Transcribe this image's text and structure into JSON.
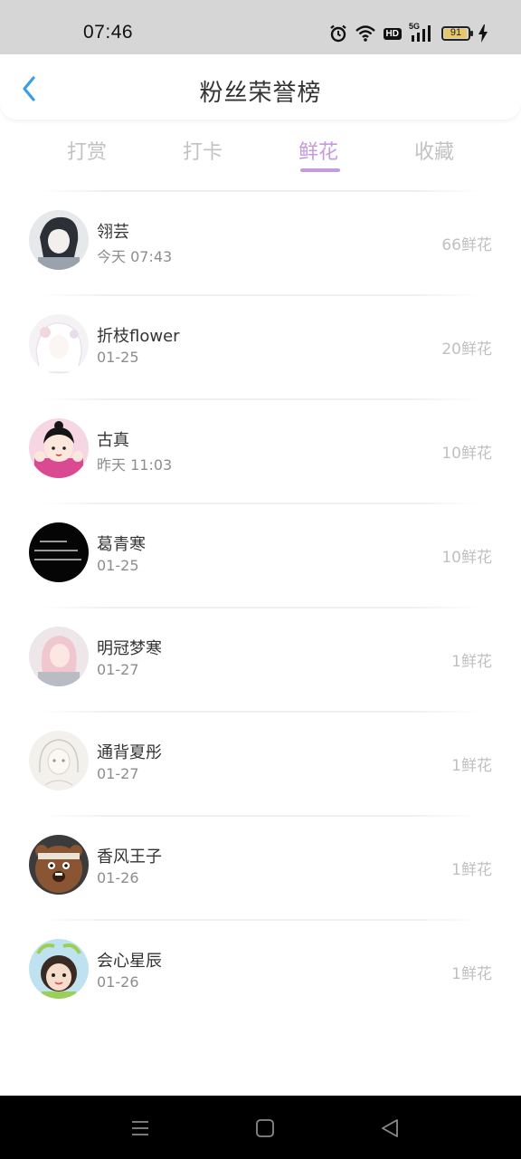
{
  "status_bar": {
    "time": "07:46",
    "network": "5G",
    "hd": "HD",
    "battery": "91"
  },
  "header": {
    "title": "粉丝荣誉榜"
  },
  "tabs": [
    {
      "label": "打赏"
    },
    {
      "label": "打卡"
    },
    {
      "label": "鲜花",
      "active": true
    },
    {
      "label": "收藏"
    }
  ],
  "fans": [
    {
      "name": "翎芸",
      "time": "今天 07:43",
      "count": "66鲜花"
    },
    {
      "name": "折枝flower",
      "time": "01-25",
      "count": "20鲜花"
    },
    {
      "name": "古真",
      "time": "昨天 11:03",
      "count": "10鲜花"
    },
    {
      "name": "葛青寒",
      "time": "01-25",
      "count": "10鲜花"
    },
    {
      "name": "明冠梦寒",
      "time": "01-27",
      "count": "1鲜花"
    },
    {
      "name": "通背夏彤",
      "time": "01-27",
      "count": "1鲜花"
    },
    {
      "name": "香风王子",
      "time": "01-26",
      "count": "1鲜花"
    },
    {
      "name": "会心星辰",
      "time": "01-26",
      "count": "1鲜花"
    }
  ],
  "colors": {
    "accent": "#c79ae0",
    "back_arrow": "#3a9ee4",
    "inactive_tab": "#c2c2c2"
  },
  "icons": [
    "alarm-icon",
    "wifi-icon",
    "hd-icon",
    "signal-icon",
    "battery-icon",
    "charging-icon",
    "back-arrow-icon",
    "menu-icon",
    "home-icon",
    "back-triangle-icon"
  ]
}
